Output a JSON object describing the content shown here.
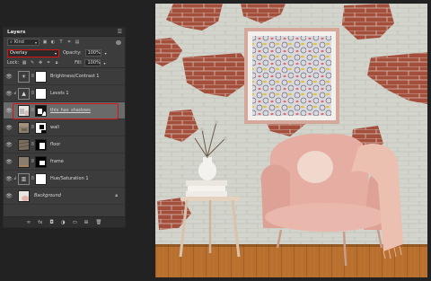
{
  "panel": {
    "title": "Layers",
    "menu_icon": "panel-menu-icon",
    "filter": {
      "kind_label": "Kind",
      "icons": [
        "image-filter-icon",
        "adjustment-filter-icon",
        "type-filter-icon",
        "shape-filter-icon",
        "smart-object-filter-icon"
      ]
    },
    "blend_mode": "Overlay",
    "opacity_label": "Opacity:",
    "opacity_value": "100%",
    "lock_label": "Lock:",
    "fill_label": "Fill:",
    "fill_value": "100%",
    "layers": [
      {
        "name": "Brightness/Contrast 1",
        "type": "adjustment",
        "adj_icon": "sun-icon"
      },
      {
        "name": "Levels 1",
        "type": "adjustment",
        "adj_icon": "levels-icon"
      },
      {
        "name": "this_has_shadows",
        "type": "smart",
        "selected": true
      },
      {
        "name": "wall",
        "type": "masked"
      },
      {
        "name": "floor",
        "type": "masked"
      },
      {
        "name": "frame",
        "type": "masked"
      },
      {
        "name": "Hue/Saturation 1",
        "type": "adjustment",
        "adj_icon": "hue-sat-icon"
      },
      {
        "name": "Background",
        "type": "background"
      }
    ],
    "footer_icons": [
      "link-layers-icon",
      "fx-icon",
      "add-mask-icon",
      "new-adjustment-icon",
      "new-group-icon",
      "new-layer-icon",
      "trash-icon"
    ],
    "footer_glyphs": [
      "∞",
      "fx",
      "◘",
      "◑",
      "▭",
      "⊞",
      "🗑"
    ]
  },
  "colors": {
    "highlight": "#d01818",
    "panel_bg": "#3c3c3c",
    "selected_row": "#6a6a6a",
    "wall": "#cfcfc8",
    "brick": "#a24e3a",
    "floor": "#b76a2b",
    "chair": "#e8b2a8"
  }
}
